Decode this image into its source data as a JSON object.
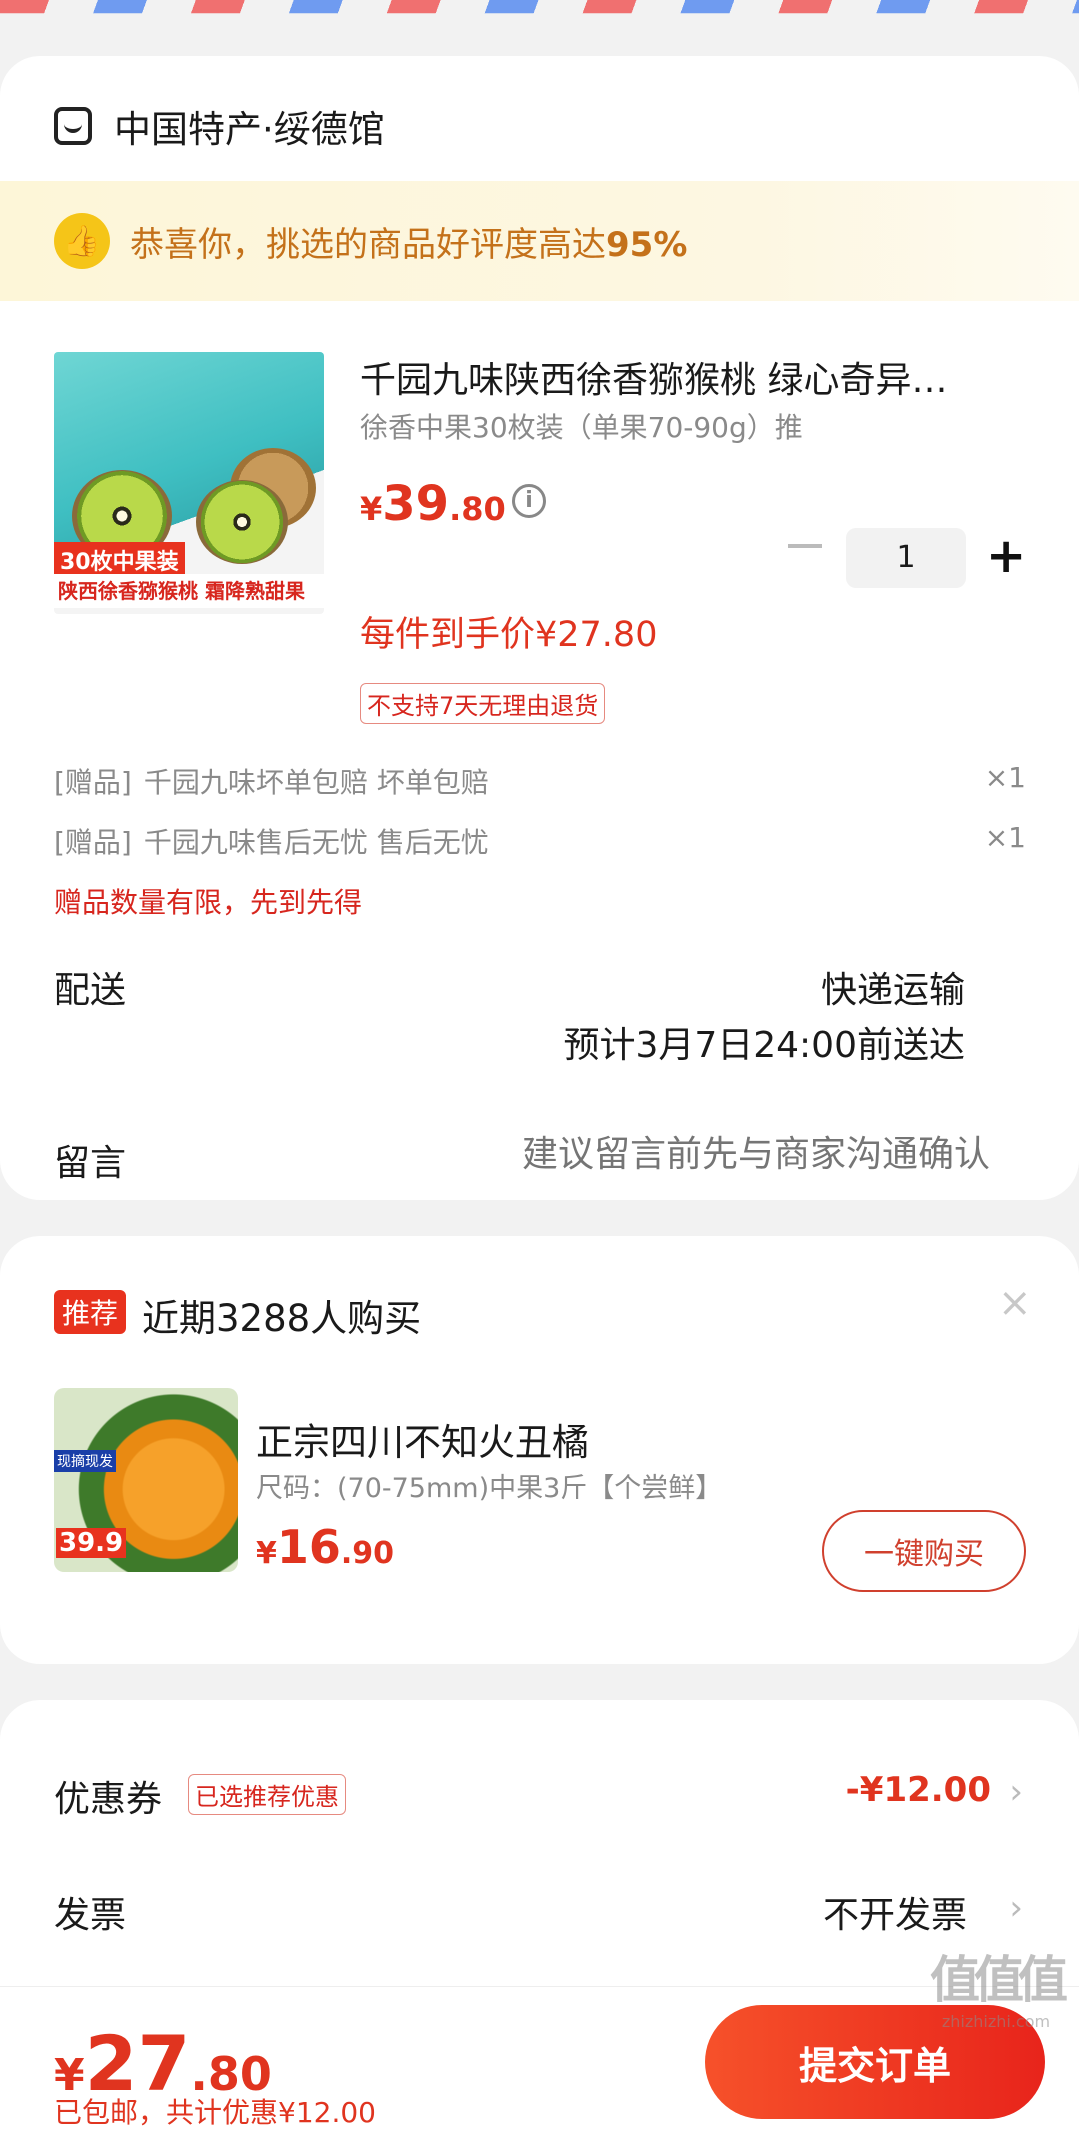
{
  "shop": {
    "name": "中国特产·绥德馆"
  },
  "praise": {
    "text": "恭喜你，挑选的商品好评度高达",
    "percent": "95%"
  },
  "product": {
    "image_badge": "30枚中果装",
    "image_caption": "陕西徐香猕猴桃 霜降熟甜果",
    "title": "千园九味陕西徐香猕猴桃 绿心奇异…",
    "spec": "徐香中果30枚装（单果70-90g）推",
    "price_yen": "¥",
    "price_int": "39",
    "price_dec": ".80",
    "quantity": "1",
    "unit_price": "每件到手价¥27.80",
    "return_policy": "不支持7天无理由退货"
  },
  "gifts": [
    {
      "label": "[赠品]",
      "name": "千园九味坏单包赔 坏单包赔",
      "qty": "×1"
    },
    {
      "label": "[赠品]",
      "name": "千园九味售后无忧 售后无忧",
      "qty": "×1"
    }
  ],
  "gift_note": "赠品数量有限，先到先得",
  "delivery": {
    "label": "配送",
    "method": "快递运输",
    "eta": "预计3月7日24:00前送达"
  },
  "remark": {
    "label": "留言",
    "placeholder": "建议留言前先与商家沟通确认"
  },
  "recommend": {
    "tag": "推荐",
    "title": "近期3288人购买",
    "close": "×",
    "image_badge": "现摘现发",
    "image_price": "39.9",
    "name": "正宗四川不知火丑橘",
    "spec": "尺码：(70-75mm)中果3斤【个尝鲜】",
    "price_yen": "¥",
    "price_int": "16",
    "price_dec": ".90",
    "buy_label": "一键购买"
  },
  "coupon": {
    "label": "优惠券",
    "tag": "已选推荐优惠",
    "value": "-¥12.00"
  },
  "invoice": {
    "label": "发票",
    "value": "不开发票"
  },
  "bottom": {
    "yen": "¥",
    "total_int": "27",
    "total_dec": ".80",
    "sub": "已包邮，共计优惠¥12.00",
    "submit": "提交订单"
  },
  "watermark": {
    "glyph": "值值值",
    "url": "zhizhizhi.com"
  },
  "colors": {
    "accent": "#e0341f",
    "praise_text": "#c4711a",
    "praise_bg": "#fdf6d8"
  }
}
